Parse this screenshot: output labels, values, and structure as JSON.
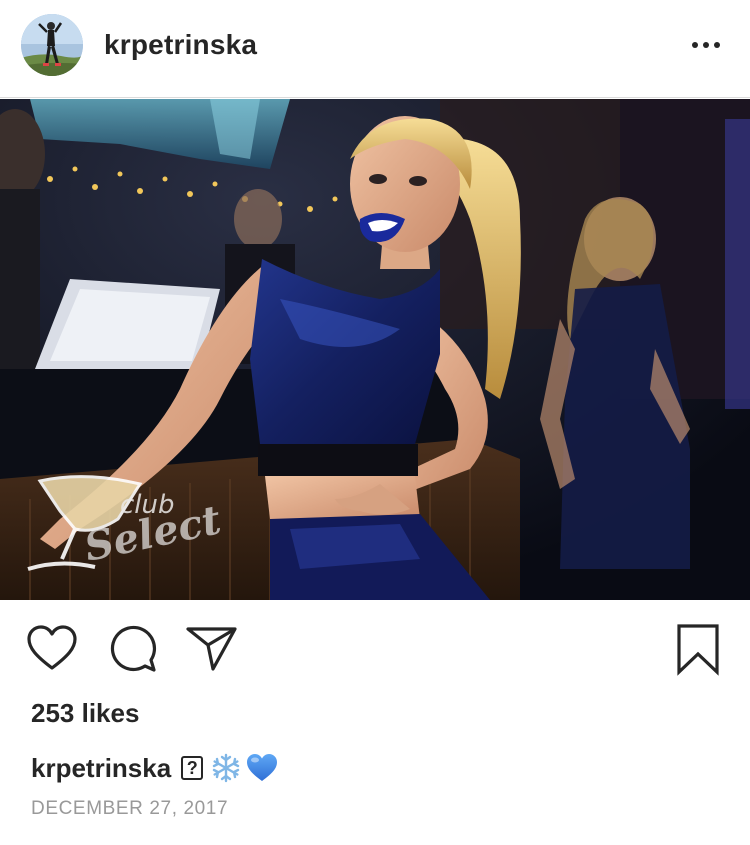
{
  "post": {
    "username": "krpetrinska",
    "more_icon": "more-horizontal-icon",
    "photo_watermark": "club Select",
    "likes_text": "253 likes",
    "caption": {
      "username": "krpetrinska",
      "unknown_glyph": "?",
      "emojis": [
        "snowflake-icon",
        "blue-heart-icon"
      ]
    },
    "date": "DECEMBER 27, 2017"
  },
  "actions": {
    "like_icon": "heart-outline-icon",
    "comment_icon": "comment-bubble-icon",
    "share_icon": "paper-plane-icon",
    "save_icon": "bookmark-icon"
  },
  "colors": {
    "text": "#262626",
    "muted": "#999999",
    "divider": "#dbdbdb",
    "emoji_blue": "#4a8fe8"
  }
}
